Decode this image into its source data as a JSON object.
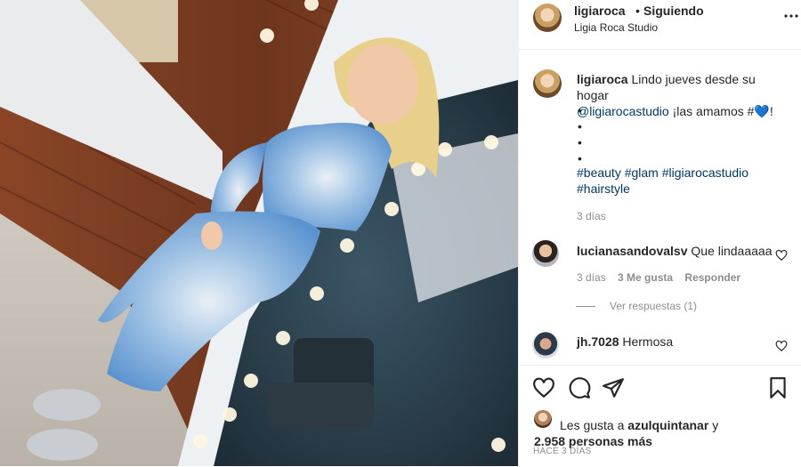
{
  "header": {
    "username": "ligiaroca",
    "separator": "•",
    "follow_status": "Siguiendo",
    "location": "Ligia Roca Studio"
  },
  "caption": {
    "username": "ligiaroca",
    "text": "Lindo jueves desde su hogar",
    "mention": "@ligiarocastudio",
    "text2": "¡las amamos #💙!",
    "bullets": [
      "•",
      "•",
      "•",
      "•"
    ],
    "hashtags_line1": "#beauty #glam #ligiarocastudio",
    "hashtags_line2": "#hairstyle",
    "time": "3 días"
  },
  "comments": [
    {
      "username": "lucianasandovalsv",
      "text": "Que lindaaaaa",
      "time": "3 días",
      "likes": "3 Me gusta",
      "reply": "Responder",
      "view_replies": "Ver respuestas (1)"
    },
    {
      "username": "jh.7028",
      "text": "Hermosa"
    }
  ],
  "footer": {
    "likes_prefix": "Les gusta a",
    "likes_user": "azulquintanar",
    "likes_and": "y",
    "likes_count": "2.958 personas más",
    "posted": "HACE 3 DÍAS"
  },
  "icons": {
    "more": "more-options-icon",
    "like": "heart-icon",
    "comment": "comment-icon",
    "share": "share-icon",
    "save": "bookmark-icon"
  },
  "colors": {
    "link": "#00376b",
    "muted": "#8e8e8e",
    "text": "#262626",
    "heart_emoji": "#1c4a8c"
  }
}
